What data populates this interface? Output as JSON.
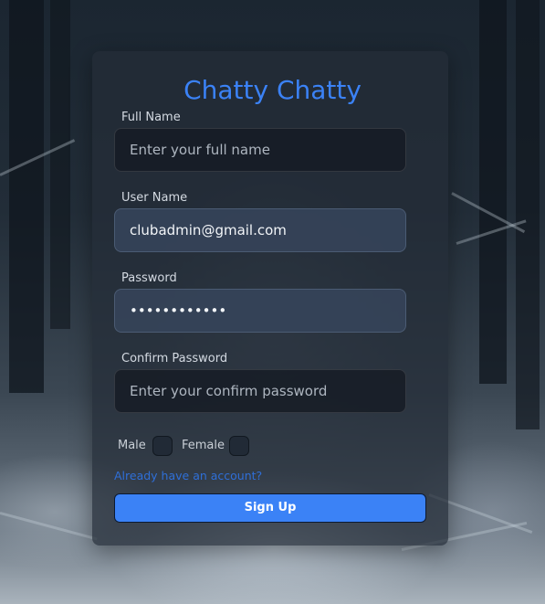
{
  "form": {
    "title": "Chatty Chatty",
    "full_name": {
      "label": "Full Name",
      "placeholder": "Enter your full name",
      "value": ""
    },
    "user_name": {
      "label": "User Name",
      "placeholder": "",
      "value": "clubadmin@gmail.com"
    },
    "password": {
      "label": "Password",
      "placeholder": "",
      "value": "123456789012"
    },
    "confirm_password": {
      "label": "Confirm Password",
      "placeholder": "Enter your confirm password",
      "value": ""
    },
    "gender": {
      "male_label": "Male",
      "female_label": "Female",
      "male_checked": false,
      "female_checked": false
    },
    "login_link": "Already have an account?",
    "submit_label": "Sign Up"
  },
  "colors": {
    "accent": "#3b82f6",
    "link": "#2f6fd8",
    "card_bg": "#242d38"
  }
}
